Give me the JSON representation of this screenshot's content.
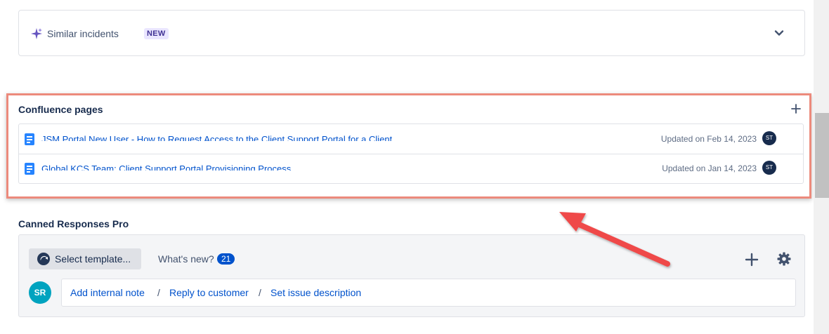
{
  "similar_incidents": {
    "title": "Similar incidents",
    "badge": "NEW",
    "icon": "sparkle-icon",
    "toggle_icon": "chevron-down-icon"
  },
  "confluence": {
    "title": "Confluence pages",
    "add_icon": "plus-icon",
    "pages": [
      {
        "title": "JSM Portal New User - How to Request Access to the Client Support Portal for a Client",
        "updated": "Updated on Feb 14, 2023",
        "avatar": "ST"
      },
      {
        "title": "Global KCS Team: Client Support Portal Provisioning Process",
        "updated": "Updated on Jan 14, 2023",
        "avatar": "ST"
      }
    ]
  },
  "canned": {
    "title": "Canned Responses Pro",
    "select_template": "Select template...",
    "whats_new": "What's new?",
    "whats_new_count": "21",
    "user_avatar": "SR",
    "actions": [
      "Add internal note",
      "Reply to customer",
      "Set issue description"
    ],
    "separator": "/"
  },
  "colors": {
    "highlight_border": "#ec8a7c",
    "arrow": "#ef4a4a",
    "link": "#0052cc",
    "badge_bg": "#eae6ff",
    "badge_text": "#403294"
  }
}
